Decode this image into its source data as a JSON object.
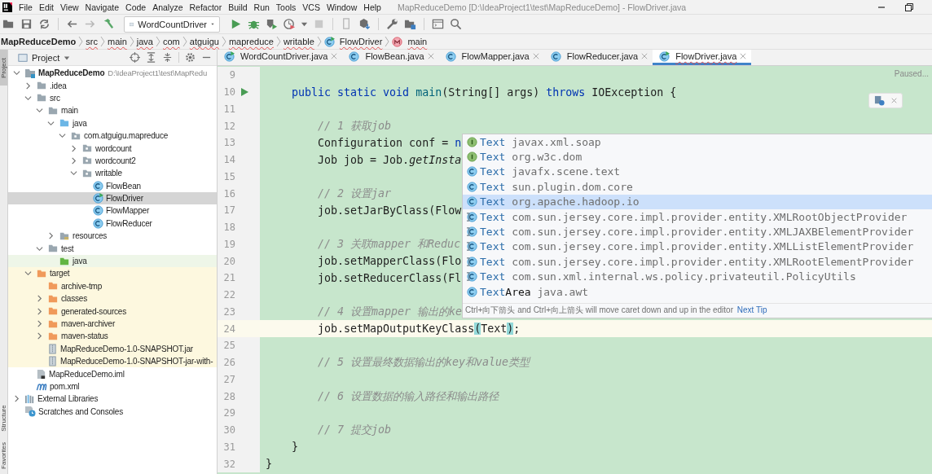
{
  "menu": [
    "File",
    "Edit",
    "View",
    "Navigate",
    "Code",
    "Analyze",
    "Refactor",
    "Build",
    "Run",
    "Tools",
    "VCS",
    "Window",
    "Help"
  ],
  "window": {
    "title": "MapReduceDemo [D:\\IdeaProject1\\test\\MapReduceDemo] - FlowDriver.java"
  },
  "toolbar": {
    "run_config": "WordCountDriver"
  },
  "breadcrumbs": [
    {
      "label": "MapReduceDemo",
      "kind": "project"
    },
    {
      "label": "src",
      "kind": "dir"
    },
    {
      "label": "main",
      "kind": "dir"
    },
    {
      "label": "java",
      "kind": "dir"
    },
    {
      "label": "com",
      "kind": "dir"
    },
    {
      "label": "atguigu",
      "kind": "dir"
    },
    {
      "label": "mapreduce",
      "kind": "dir"
    },
    {
      "label": "writable",
      "kind": "dir"
    },
    {
      "label": "FlowDriver",
      "kind": "class"
    },
    {
      "label": "main",
      "kind": "method"
    }
  ],
  "side_stripe": [
    "Project",
    "Structure",
    "Favorites"
  ],
  "project_panel": {
    "title": "Project"
  },
  "tree": [
    {
      "label": "MapReduceDemo",
      "note": "D:\\IdeaProject1\\test\\MapRedu",
      "kind": "module",
      "expanded": true,
      "selected": false,
      "children": [
        {
          "label": ".idea",
          "kind": "folder",
          "expanded": false,
          "selected": false
        },
        {
          "label": "src",
          "kind": "folder",
          "expanded": true,
          "selected": false,
          "children": [
            {
              "label": "main",
              "kind": "folder",
              "expanded": true,
              "selected": false,
              "children": [
                {
                  "label": "java",
                  "kind": "source",
                  "expanded": true,
                  "selected": false,
                  "children": [
                    {
                      "label": "com.atguigu.mapreduce",
                      "kind": "package",
                      "expanded": true,
                      "selected": false,
                      "children": [
                        {
                          "label": "wordcount",
                          "kind": "package",
                          "expanded": false,
                          "selected": false
                        },
                        {
                          "label": "wordcount2",
                          "kind": "package",
                          "expanded": false,
                          "selected": false
                        },
                        {
                          "label": "writable",
                          "kind": "package",
                          "expanded": true,
                          "selected": false,
                          "children": [
                            {
                              "label": "FlowBean",
                              "kind": "class",
                              "selected": false
                            },
                            {
                              "label": "FlowDriver",
                              "kind": "runclass",
                              "selected": true
                            },
                            {
                              "label": "FlowMapper",
                              "kind": "class",
                              "selected": false
                            },
                            {
                              "label": "FlowReducer",
                              "kind": "class",
                              "selected": false
                            }
                          ]
                        }
                      ]
                    }
                  ]
                },
                {
                  "label": "resources",
                  "kind": "resources",
                  "expanded": false,
                  "selected": false
                }
              ]
            },
            {
              "label": "test",
              "kind": "folder",
              "expanded": true,
              "selected": false,
              "children": [
                {
                  "label": "java",
                  "kind": "test",
                  "selected": false
                }
              ]
            }
          ]
        },
        {
          "label": "target",
          "kind": "excluded",
          "expanded": true,
          "selected": false,
          "children": [
            {
              "label": "archive-tmp",
              "kind": "excluded",
              "selected": false
            },
            {
              "label": "classes",
              "kind": "excluded",
              "expanded": false,
              "selected": false
            },
            {
              "label": "generated-sources",
              "kind": "excluded",
              "expanded": false,
              "selected": false
            },
            {
              "label": "maven-archiver",
              "kind": "excluded",
              "expanded": false,
              "selected": false
            },
            {
              "label": "maven-status",
              "kind": "excluded",
              "expanded": false,
              "selected": false
            },
            {
              "label": "MapReduceDemo-1.0-SNAPSHOT.jar",
              "kind": "jar",
              "selected": false
            },
            {
              "label": "MapReduceDemo-1.0-SNAPSHOT-jar-with-",
              "kind": "jar",
              "selected": false
            }
          ]
        },
        {
          "label": "MapReduceDemo.iml",
          "kind": "iml",
          "selected": false
        },
        {
          "label": "pom.xml",
          "kind": "maven",
          "selected": false
        }
      ]
    },
    {
      "label": "External Libraries",
      "kind": "libraries",
      "expanded": false,
      "selected": false
    },
    {
      "label": "Scratches and Consoles",
      "kind": "scratches",
      "selected": false
    }
  ],
  "tabs": [
    {
      "label": "WordCountDriver.java",
      "kind": "runclass",
      "selected": false
    },
    {
      "label": "FlowBean.java",
      "kind": "class",
      "selected": false
    },
    {
      "label": "FlowMapper.java",
      "kind": "class",
      "selected": false
    },
    {
      "label": "FlowReducer.java",
      "kind": "class",
      "selected": false
    },
    {
      "label": "FlowDriver.java",
      "kind": "runclass",
      "selected": true
    }
  ],
  "editor": {
    "status": "Paused...",
    "lines": [
      {
        "number": "9",
        "current": false,
        "run": false
      },
      {
        "number": "10",
        "current": false,
        "run": true,
        "segments": [
          {
            "kind": "keyword",
            "text": "    public static void "
          },
          {
            "kind": "method",
            "text": "main"
          },
          {
            "kind": "plain",
            "text": "(String[] args) "
          },
          {
            "kind": "keyword",
            "text": "throws "
          },
          {
            "kind": "plain",
            "text": "IOException {"
          }
        ]
      },
      {
        "number": "11",
        "current": false,
        "run": false
      },
      {
        "number": "12",
        "current": false,
        "run": false,
        "segments": [
          {
            "kind": "comment",
            "text": "        // 1 获取job"
          }
        ]
      },
      {
        "number": "13",
        "current": false,
        "run": false,
        "segments": [
          {
            "kind": "plain",
            "text": "        Configuration conf = "
          },
          {
            "kind": "keyword",
            "text": "n"
          }
        ]
      },
      {
        "number": "14",
        "current": false,
        "run": false,
        "segments": [
          {
            "kind": "plain",
            "text": "        Job job = Job."
          },
          {
            "kind": "italic",
            "text": "getInsta"
          }
        ]
      },
      {
        "number": "15",
        "current": false,
        "run": false
      },
      {
        "number": "16",
        "current": false,
        "run": false,
        "segments": [
          {
            "kind": "comment",
            "text": "        // 2 设置jar"
          }
        ]
      },
      {
        "number": "17",
        "current": false,
        "run": false,
        "segments": [
          {
            "kind": "plain",
            "text": "        job.setJarByClass(Flow"
          }
        ]
      },
      {
        "number": "18",
        "current": false,
        "run": false
      },
      {
        "number": "19",
        "current": false,
        "run": false,
        "segments": [
          {
            "kind": "comment",
            "text": "        // 3 关联mapper 和Reduc"
          }
        ]
      },
      {
        "number": "20",
        "current": false,
        "run": false,
        "segments": [
          {
            "kind": "plain",
            "text": "        job.setMapperClass(Flo"
          }
        ]
      },
      {
        "number": "21",
        "current": false,
        "run": false,
        "segments": [
          {
            "kind": "plain",
            "text": "        job.setReducerClass(Fl"
          }
        ]
      },
      {
        "number": "22",
        "current": false,
        "run": false
      },
      {
        "number": "23",
        "current": false,
        "run": false,
        "segments": [
          {
            "kind": "comment",
            "text": "        // 4 设置mapper 输出的ke"
          }
        ]
      },
      {
        "number": "24",
        "current": true,
        "run": false,
        "segments": [
          {
            "kind": "plain",
            "text": "        job.setMapOutputKeyClass"
          },
          {
            "kind": "brace",
            "text": "("
          },
          {
            "kind": "plain",
            "text": "Text"
          },
          {
            "kind": "brace",
            "text": ")"
          },
          {
            "kind": "plain",
            "text": ";"
          }
        ]
      },
      {
        "number": "25",
        "current": false,
        "run": false
      },
      {
        "number": "26",
        "current": false,
        "run": false,
        "segments": [
          {
            "kind": "comment",
            "text": "        // 5 设置最终数据输出的key和value类型"
          }
        ]
      },
      {
        "number": "27",
        "current": false,
        "run": false
      },
      {
        "number": "28",
        "current": false,
        "run": false,
        "segments": [
          {
            "kind": "comment",
            "text": "        // 6 设置数据的输入路径和输出路径"
          }
        ]
      },
      {
        "number": "29",
        "current": false,
        "run": false
      },
      {
        "number": "30",
        "current": false,
        "run": false,
        "segments": [
          {
            "kind": "comment",
            "text": "        // 7 提交job"
          }
        ]
      },
      {
        "number": "31",
        "current": false,
        "run": false,
        "segments": [
          {
            "kind": "plain",
            "text": "    }"
          }
        ]
      },
      {
        "number": "32",
        "current": false,
        "run": false,
        "segments": [
          {
            "kind": "plain",
            "text": "}"
          }
        ]
      }
    ]
  },
  "completion": {
    "items": [
      {
        "kind": "interface",
        "match": "Text",
        "package": "javax.xml.soap",
        "selected": false
      },
      {
        "kind": "interface",
        "match": "Text",
        "package": "org.w3c.dom",
        "selected": false
      },
      {
        "kind": "class",
        "match": "Text",
        "package": "javafx.scene.text",
        "selected": false
      },
      {
        "kind": "class",
        "match": "Text",
        "package": "sun.plugin.dom.core",
        "selected": false
      },
      {
        "kind": "class",
        "match": "Text",
        "package": "org.apache.hadoop.io",
        "selected": true
      },
      {
        "kind": "generic",
        "match": "Text",
        "package": "com.sun.jersey.core.impl.provider.entity.XMLRootObjectProvider",
        "selected": false
      },
      {
        "kind": "generic",
        "match": "Text",
        "package": "com.sun.jersey.core.impl.provider.entity.XMLJAXBElementProvider",
        "selected": false
      },
      {
        "kind": "generic",
        "match": "Text",
        "package": "com.sun.jersey.core.impl.provider.entity.XMLListElementProvider",
        "selected": false
      },
      {
        "kind": "generic",
        "match": "Text",
        "package": "com.sun.jersey.core.impl.provider.entity.XMLRootElementProvider",
        "selected": false
      },
      {
        "kind": "generic",
        "match": "Text",
        "package": "com.sun.xml.internal.ws.policy.privateutil.PolicyUtils",
        "selected": false
      },
      {
        "kind": "class",
        "match": "Text",
        "rest": "Area",
        "package": "java.awt",
        "selected": false
      }
    ],
    "hint": "Ctrl+向下箭头 and Ctrl+向上箭头 will move caret down and up in the editor",
    "hint_link": "Next Tip"
  }
}
